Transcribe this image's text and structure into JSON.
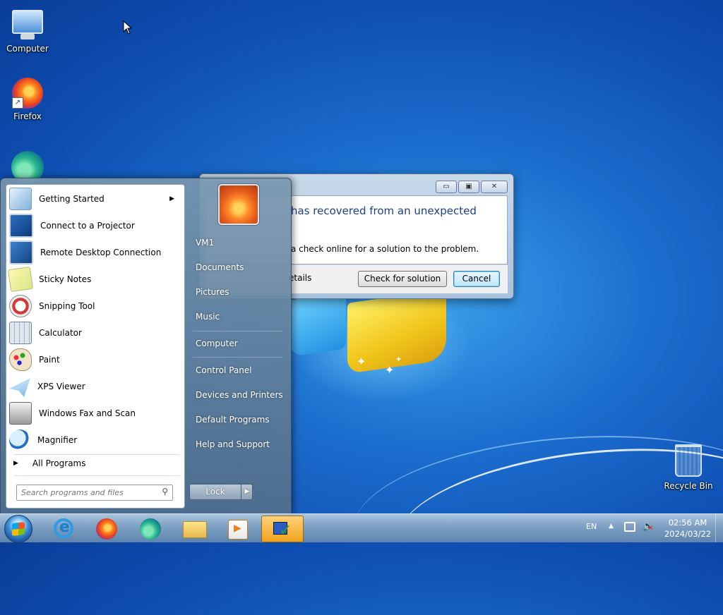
{
  "desktop": {
    "icons": [
      {
        "label": "Computer"
      },
      {
        "label": "Firefox"
      },
      {
        "label": "Microsoft Edge"
      },
      {
        "label": "Recycle Bin"
      }
    ]
  },
  "dialog": {
    "heading": "has recovered from an unexpected",
    "body_text": "a check online for a solution to the problem.",
    "details_text": "etails",
    "check_button": "Check for solution",
    "cancel_button": "Cancel",
    "minimize_glyph": "▭",
    "maximize_glyph": "▣",
    "close_glyph": "✕"
  },
  "start_menu": {
    "programs": [
      {
        "label": "Getting Started",
        "icon": "getting-started-icon",
        "has_submenu": true
      },
      {
        "label": "Connect to a Projector",
        "icon": "projector-icon"
      },
      {
        "label": "Remote Desktop Connection",
        "icon": "remote-desktop-icon"
      },
      {
        "label": "Sticky Notes",
        "icon": "sticky-notes-icon"
      },
      {
        "label": "Snipping Tool",
        "icon": "snipping-tool-icon"
      },
      {
        "label": "Calculator",
        "icon": "calculator-icon"
      },
      {
        "label": "Paint",
        "icon": "paint-icon"
      },
      {
        "label": "XPS Viewer",
        "icon": "xps-viewer-icon"
      },
      {
        "label": "Windows Fax and Scan",
        "icon": "fax-scan-icon"
      },
      {
        "label": "Magnifier",
        "icon": "magnifier-icon"
      }
    ],
    "all_programs": "All Programs",
    "search_placeholder": "Search programs and files",
    "right_items": [
      {
        "label": "VM1"
      },
      {
        "label": "Documents"
      },
      {
        "label": "Pictures"
      },
      {
        "label": "Music"
      },
      {
        "label": "Computer"
      },
      {
        "label": "Control Panel"
      },
      {
        "label": "Devices and Printers"
      },
      {
        "label": "Default Programs"
      },
      {
        "label": "Help and Support"
      }
    ],
    "lock_label": "Lock"
  },
  "taskbar": {
    "apps": [
      "internet-explorer-icon",
      "firefox-icon",
      "edge-icon",
      "file-explorer-icon",
      "media-player-icon",
      "action-center-icon"
    ],
    "language": "EN",
    "time": "02:56 AM",
    "date": "2024/03/22"
  },
  "colors": {
    "accent": "#1e3f87",
    "taskbar_active": "#f0a21c",
    "desktop": "#1c6fcf"
  }
}
